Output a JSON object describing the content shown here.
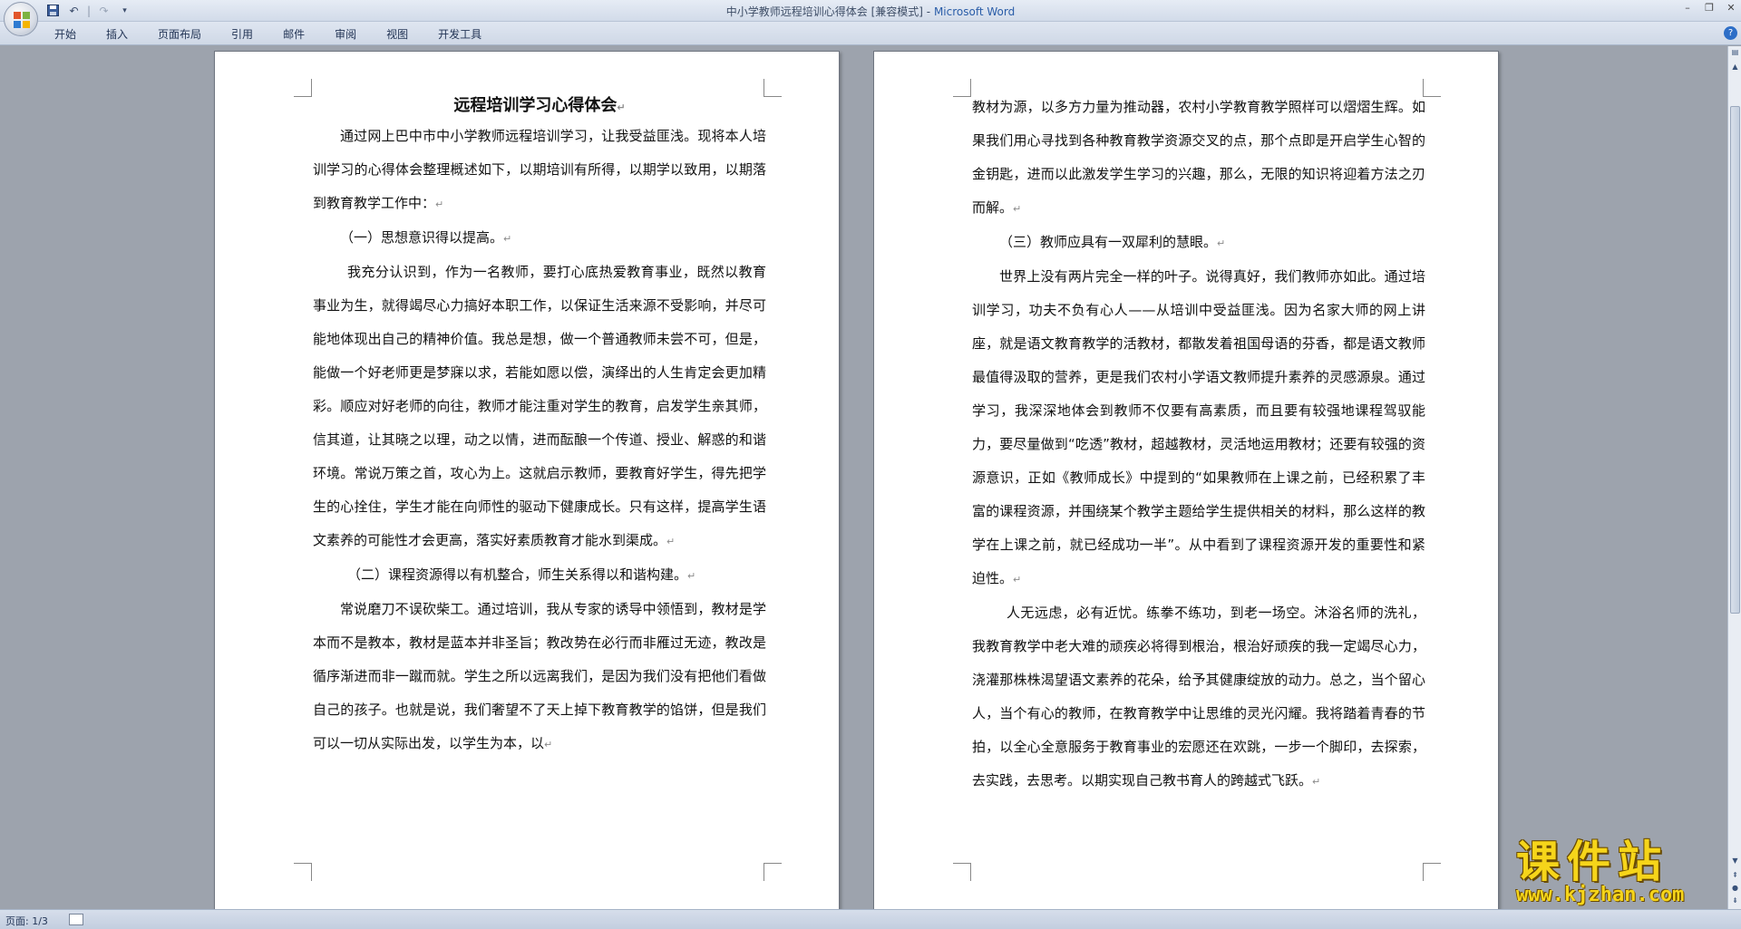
{
  "window": {
    "title_doc": "中小学教师远程培训心得体会 [兼容模式]",
    "title_sep": " - ",
    "title_app": "Microsoft Word"
  },
  "ribbon": {
    "tabs": [
      "开始",
      "插入",
      "页面布局",
      "引用",
      "邮件",
      "审阅",
      "视图",
      "开发工具"
    ]
  },
  "page_left": {
    "title": "远程培训学习心得体会",
    "paragraphs": [
      {
        "style": "indent",
        "text": "通过网上巴中市中小学教师远程培训学习，让我受益匪浅。现将本人培训学习的心得体会整理概述如下，以期培训有所得，以期学以致用，以期落到教育教学工作中："
      },
      {
        "style": "indent",
        "text": "（一）思想意识得以提高。"
      },
      {
        "style": "indent2",
        "text": "我充分认识到，作为一名教师，要打心底热爱教育事业，既然以教育事业为生，就得竭尽心力搞好本职工作，以保证生活来源不受影响，并尽可能地体现出自己的精神价值。我总是想，做一个普通教师未尝不可，但是，能做一个好老师更是梦寐以求，若能如愿以偿，演绎出的人生肯定会更加精彩。顺应对好老师的向往，教师才能注重对学生的教育，启发学生亲其师，信其道，让其晓之以理，动之以情，进而酝酿一个传道、授业、解惑的和谐环境。常说万策之首，攻心为上。这就启示教师，要教育好学生，得先把学生的心拴住，学生才能在向师性的驱动下健康成长。只有这样，提高学生语文素养的可能性才会更高，落实好素质教育才能水到渠成。"
      },
      {
        "style": "indent2",
        "text": "（二）课程资源得以有机整合，师生关系得以和谐构建。"
      },
      {
        "style": "indent",
        "text": "常说磨刀不误砍柴工。通过培训，我从专家的诱导中领悟到，教材是学本而不是教本，教材是蓝本并非圣旨；教改势在必行而非雁过无迹，教改是循序渐进而非一蹴而就。学生之所以远离我们，是因为我们没有把他们看做自己的孩子。也就是说，我们奢望不了天上掉下教育教学的馅饼，但是我们可以一切从实际出发，以学生为本，以"
      }
    ]
  },
  "page_right": {
    "paragraphs": [
      {
        "style": "plain",
        "text": "教材为源，以多方力量为推动器，农村小学教育教学照样可以熠熠生辉。如果我们用心寻找到各种教育教学资源交叉的点，那个点即是开启学生心智的金钥匙，进而以此激发学生学习的兴趣，那么，无限的知识将迎着方法之刃而解。"
      },
      {
        "style": "indent",
        "text": "（三）教师应具有一双犀利的慧眼。"
      },
      {
        "style": "indent",
        "text": "世界上没有两片完全一样的叶子。说得真好，我们教师亦如此。通过培训学习，功夫不负有心人——从培训中受益匪浅。因为名家大师的网上讲座，就是语文教育教学的活教材，都散发着祖国母语的芬香，都是语文教师最值得汲取的营养，更是我们农村小学语文教师提升素养的灵感源泉。通过学习，我深深地体会到教师不仅要有高素质，而且要有较强地课程驾驭能力，要尽量做到“吃透”教材，超越教材，灵活地运用教材；还要有较强的资源意识，正如《教师成长》中提到的“如果教师在上课之前，已经积累了丰富的课程资源，并围绕某个教学主题给学生提供相关的材料，那么这样的教学在上课之前，就已经成功一半”。从中看到了课程资源开发的重要性和紧迫性。"
      },
      {
        "style": "indent2",
        "text": "人无远虑，必有近忧。练拳不练功，到老一场空。沐浴名师的洗礼，我教育教学中老大难的顽疾必将得到根治，根治好顽疾的我一定竭尽心力，浇灌那株株渴望语文素养的花朵，给予其健康绽放的动力。总之，当个留心人，当个有心的教师，在教育教学中让思维的灵光闪耀。我将踏着青春的节拍，以全心全意服务于教育事业的宏愿还在欢跳，一步一个脚印，去探索，去实践，去思考。以期实现自己教书育人的跨越式飞跃。"
      }
    ]
  },
  "paragraph_mark": "↵",
  "status": {
    "page": "页面: 1/3"
  },
  "watermark": {
    "main": "课件站",
    "url": "www.kjzhan.com"
  },
  "colors": {
    "app_title": "#2a5da8",
    "watermark": "#f6d51a"
  }
}
